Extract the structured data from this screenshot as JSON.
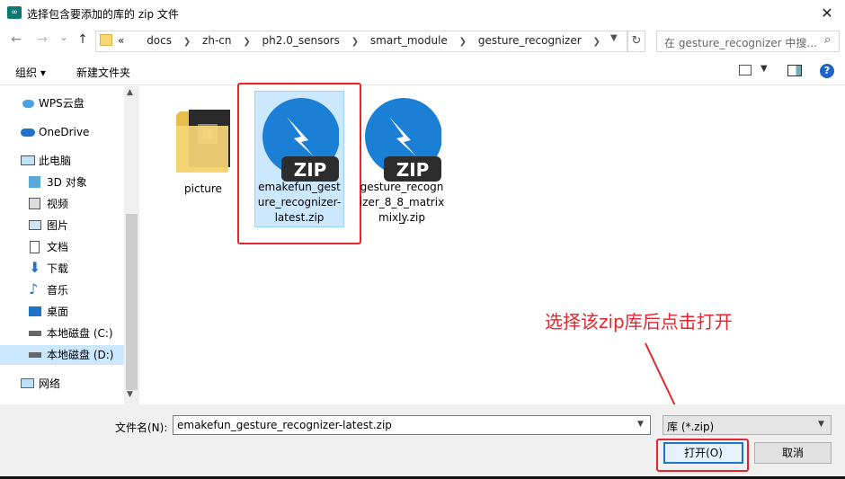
{
  "window": {
    "title": "选择包含要添加的库的 zip 文件",
    "app_icon": "infinity-icon",
    "close_glyph": "✕"
  },
  "nav": {
    "back_glyph": "←",
    "forward_glyph": "→",
    "recent_glyph": "⌄",
    "up_glyph": "↑",
    "overflow": "«",
    "breadcrumbs": [
      "docs",
      "zh-cn",
      "ph2.0_sensors",
      "smart_module",
      "gesture_recognizer"
    ],
    "refresh_glyph": "↻",
    "search_placeholder": "在 gesture_recognizer 中搜...",
    "search_glyph": "🔍"
  },
  "toolbar": {
    "organize": "组织 ▾",
    "new_folder": "新建文件夹",
    "help": "?"
  },
  "sidebar": {
    "items": [
      {
        "label": "WPS云盘",
        "icon": "cloud-icon"
      },
      {
        "label": "OneDrive",
        "icon": "onedrive-cloud-icon"
      },
      {
        "label": "此电脑",
        "icon": "computer-icon"
      },
      {
        "label": "3D 对象",
        "icon": "cube-icon"
      },
      {
        "label": "视频",
        "icon": "video-icon"
      },
      {
        "label": "图片",
        "icon": "picture-icon"
      },
      {
        "label": "文档",
        "icon": "document-icon"
      },
      {
        "label": "下载",
        "icon": "download-arrow-icon"
      },
      {
        "label": "音乐",
        "icon": "music-note-icon"
      },
      {
        "label": "桌面",
        "icon": "desktop-icon"
      },
      {
        "label": "本地磁盘 (C:)",
        "icon": "drive-icon"
      },
      {
        "label": "本地磁盘 (D:)",
        "icon": "drive-icon"
      },
      {
        "label": "网络",
        "icon": "network-icon"
      }
    ]
  },
  "files": [
    {
      "name": "picture",
      "caption_lines": [
        "picture"
      ],
      "icon": "folder-icon"
    },
    {
      "name": "emakefun_gesture_recognizer-latest.zip",
      "caption_lines": [
        "emakefun_gest",
        "ure_recognizer-",
        "latest.zip"
      ],
      "icon": "zip-icon",
      "selected": true
    },
    {
      "name": "gesture_recognizer_8_8_matrix_mixly.zip",
      "caption_lines": [
        "gesture_recogn",
        "izer_8_8_matrix_",
        "mixly.zip"
      ],
      "icon": "zip-icon"
    }
  ],
  "zip_badge": "ZIP",
  "annotation": "选择该zip库后点击打开",
  "bottom": {
    "filename_label": "文件名(N):",
    "filename_value": "emakefun_gesture_recognizer-latest.zip",
    "filetype_value": "库 (*.zip)",
    "open_button": "打开(O)",
    "cancel_button": "取消"
  },
  "colors": {
    "accent_red": "#e3262d",
    "selection": "#cce8ff",
    "zip_blue": "#1c7fd6"
  }
}
